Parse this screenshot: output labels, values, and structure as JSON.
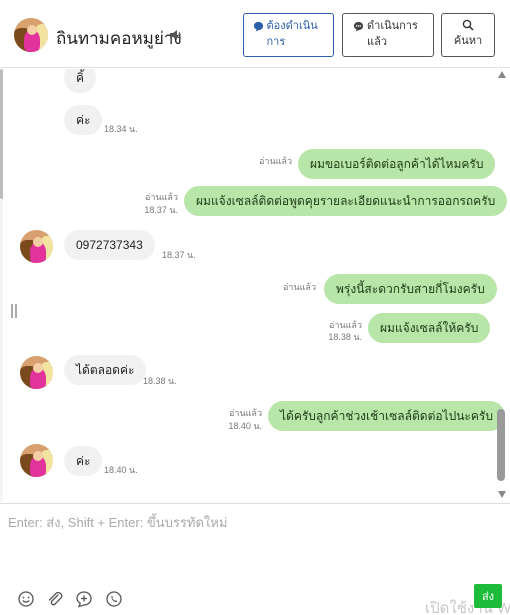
{
  "header": {
    "contact_name": "ถินทามคอหมูย่าง",
    "pending_label": "ต้องดำเนินการ",
    "done_label": "ดำเนินการแล้ว",
    "search_label": "ค้นหา"
  },
  "messages": {
    "m1": {
      "text": "คิ้",
      "sender": "contact"
    },
    "m2": {
      "text": "ค่ะ",
      "time": "18.34 น.",
      "sender": "contact"
    },
    "m3": {
      "text": "ผมขอเบอร์ติดต่อลูกค้าได้ไหมครับ",
      "read": "อ่านแล้ว",
      "sender": "me"
    },
    "m4": {
      "text": "ผมแจ้งเซลล์ติดต่อพูดคุยรายละเอียดแนะนำการออกรถครับ",
      "read": "อ่านแล้ว",
      "time": "18.37 น.",
      "sender": "me"
    },
    "m5": {
      "text": "0972737343",
      "time": "18.37 น.",
      "sender": "contact"
    },
    "m6": {
      "text": "พรุ่งนี้สะดวกรับสายกี่โมงครับ",
      "read": "อ่านแล้ว",
      "sender": "me"
    },
    "m7": {
      "text": "ผมแจ้งเซลล์ให้ครับ",
      "read": "อ่านแล้ว",
      "time": "18.38 น.",
      "sender": "me"
    },
    "m8": {
      "text": "ได้ตลอดค่ะ",
      "time": "18.38 น.",
      "sender": "contact"
    },
    "m9": {
      "text": "ได้ครับลูกค้าช่วงเช้าเซลล์ติดต่อไปนะครับ",
      "read": "อ่านแล้ว",
      "time": "18.40 น.",
      "sender": "me"
    },
    "m10": {
      "text": "ค่ะ",
      "time": "18.40 น.",
      "sender": "contact"
    }
  },
  "composer": {
    "placeholder": "Enter: ส่ง, Shift + Enter: ขึ้นบรรทัดใหม่",
    "send_label": "ส่ง",
    "watermark": "เปิดใช้งาน W"
  },
  "icons": {
    "speaker": "speaker-icon",
    "pending": "chat-bubble-icon",
    "done": "chat-bubble-icon",
    "search": "search-icon",
    "emoji": "emoji-icon",
    "attach": "paperclip-icon",
    "quick_reply": "add-message-icon",
    "whatsapp": "phone-chat-icon"
  },
  "colors": {
    "bubble_out": "#b8e6a8",
    "bubble_in": "#f1f1f1",
    "accent": "#2d5fa8",
    "send": "#1dbb3a"
  }
}
